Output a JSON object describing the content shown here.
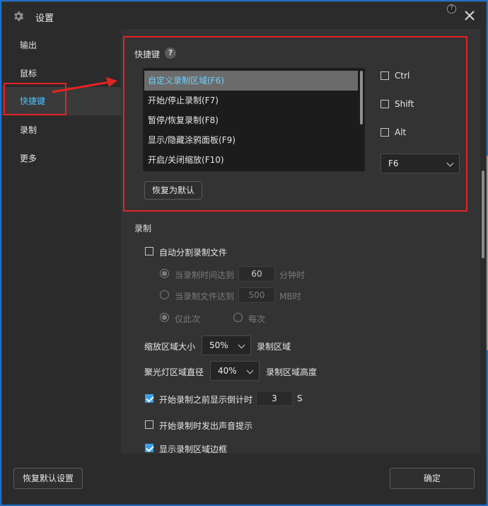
{
  "window": {
    "title": "设置",
    "close_icon": "close-icon",
    "help_small": "?"
  },
  "sidebar": {
    "items": [
      {
        "label": "输出"
      },
      {
        "label": "鼠标"
      },
      {
        "label": "快捷键",
        "active": true
      },
      {
        "label": "录制"
      },
      {
        "label": "更多"
      }
    ]
  },
  "hotkeys": {
    "section_title": "快捷键",
    "help_icon": "?",
    "list": [
      "自定义录制区域(F6)",
      "开始/停止录制(F7)",
      "暂停/恢复录制(F8)",
      "显示/隐藏涂鸦面板(F9)",
      "开启/关闭缩放(F10)"
    ],
    "selected_index": 0,
    "modifiers": {
      "ctrl": "Ctrl",
      "shift": "Shift",
      "alt": "Alt"
    },
    "key_value": "F6",
    "restore_label": "恢复为默认"
  },
  "recording": {
    "section_title": "录制",
    "auto_split": "自动分割录制文件",
    "time_reach": "当录制时间达到",
    "time_value": "60",
    "time_unit": "分钟时",
    "size_reach": "当录制文件达到",
    "size_value": "500",
    "size_unit": "MB时",
    "only_once": "仅此次",
    "every_time": "每次",
    "zoom_label": "缩放区域大小",
    "zoom_value": "50%",
    "zoom_suffix": "录制区域",
    "spot_label": "聚光灯区域直径",
    "spot_value": "40%",
    "spot_suffix": "录制区域高度",
    "countdown_label": "开始录制之前显示倒计时",
    "countdown_value": "3",
    "countdown_unit": "S",
    "sound_label": "开始录制时发出声音提示",
    "border_label": "显示录制区域边框"
  },
  "footer": {
    "restore_all": "恢复默认设置",
    "confirm": "确定"
  },
  "colors": {
    "accent": "#4fc1ff",
    "highlight_box": "#e52222",
    "checkbox_on": "#3aa0e8"
  }
}
